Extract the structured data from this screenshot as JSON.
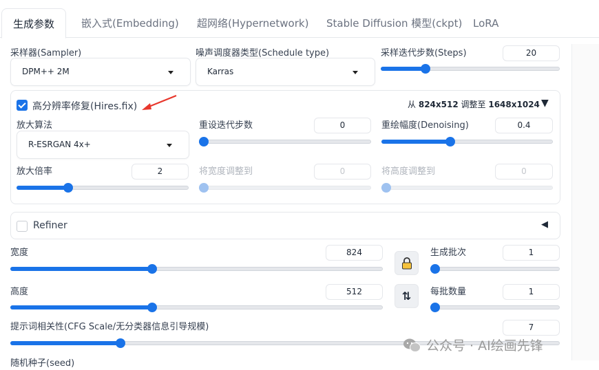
{
  "tabs": [
    {
      "label": "生成参数"
    },
    {
      "label": "嵌入式(Embedding)"
    },
    {
      "label": "超网络(Hypernetwork)"
    },
    {
      "label": "Stable Diffusion 模型(ckpt)"
    },
    {
      "label": "LoRA"
    }
  ],
  "sampler": {
    "label": "采样器(Sampler)",
    "value": "DPM++ 2M"
  },
  "schedule": {
    "label": "噪声调度器类型(Schedule type)",
    "value": "Karras"
  },
  "steps": {
    "label": "采样迭代步数(Steps)",
    "value": "20",
    "fraction": 0.25
  },
  "hires": {
    "label": "高分辨率修复(Hires.fix)",
    "enabled": true,
    "resize_info_prefix": "从",
    "resize_from": "824x512",
    "resize_mid": "调整至",
    "resize_to": "1648x1024",
    "collapse_glyph": "▼",
    "upscaler": {
      "label": "放大算法",
      "value": "R-ESRGAN 4x+"
    },
    "hires_steps": {
      "label": "重设迭代步数",
      "value": "0",
      "fraction": 0.0
    },
    "denoising": {
      "label": "重绘幅度(Denoising)",
      "value": "0.4",
      "fraction": 0.4
    },
    "upscale_by": {
      "label": "放大倍率",
      "value": "2",
      "fraction": 0.3
    },
    "resize_width": {
      "label": "将宽度调整到",
      "value": "0",
      "fraction": 0.0
    },
    "resize_height": {
      "label": "将高度调整到",
      "value": "0",
      "fraction": 0.0
    }
  },
  "refiner": {
    "label": "Refiner",
    "enabled": false,
    "expand_glyph": "◀"
  },
  "width": {
    "label": "宽度",
    "value": "824",
    "fraction": 0.38
  },
  "height": {
    "label": "高度",
    "value": "512",
    "fraction": 0.38
  },
  "batch_count": {
    "label": "生成批次",
    "value": "1",
    "fraction": 0.0
  },
  "batch_size": {
    "label": "每批数量",
    "value": "1",
    "fraction": 0.0
  },
  "cfg": {
    "label": "提示词相关性(CFG Scale/无分类器信息引导规模)",
    "value": "7",
    "fraction": 0.2
  },
  "seed": {
    "label": "随机种子(seed)"
  },
  "swap_glyph": "⇅",
  "watermark": {
    "text": "公众号 · AI绘画先锋"
  },
  "colors": {
    "accent": "#1a73e8",
    "arrow_annotation": "#e8372c"
  }
}
